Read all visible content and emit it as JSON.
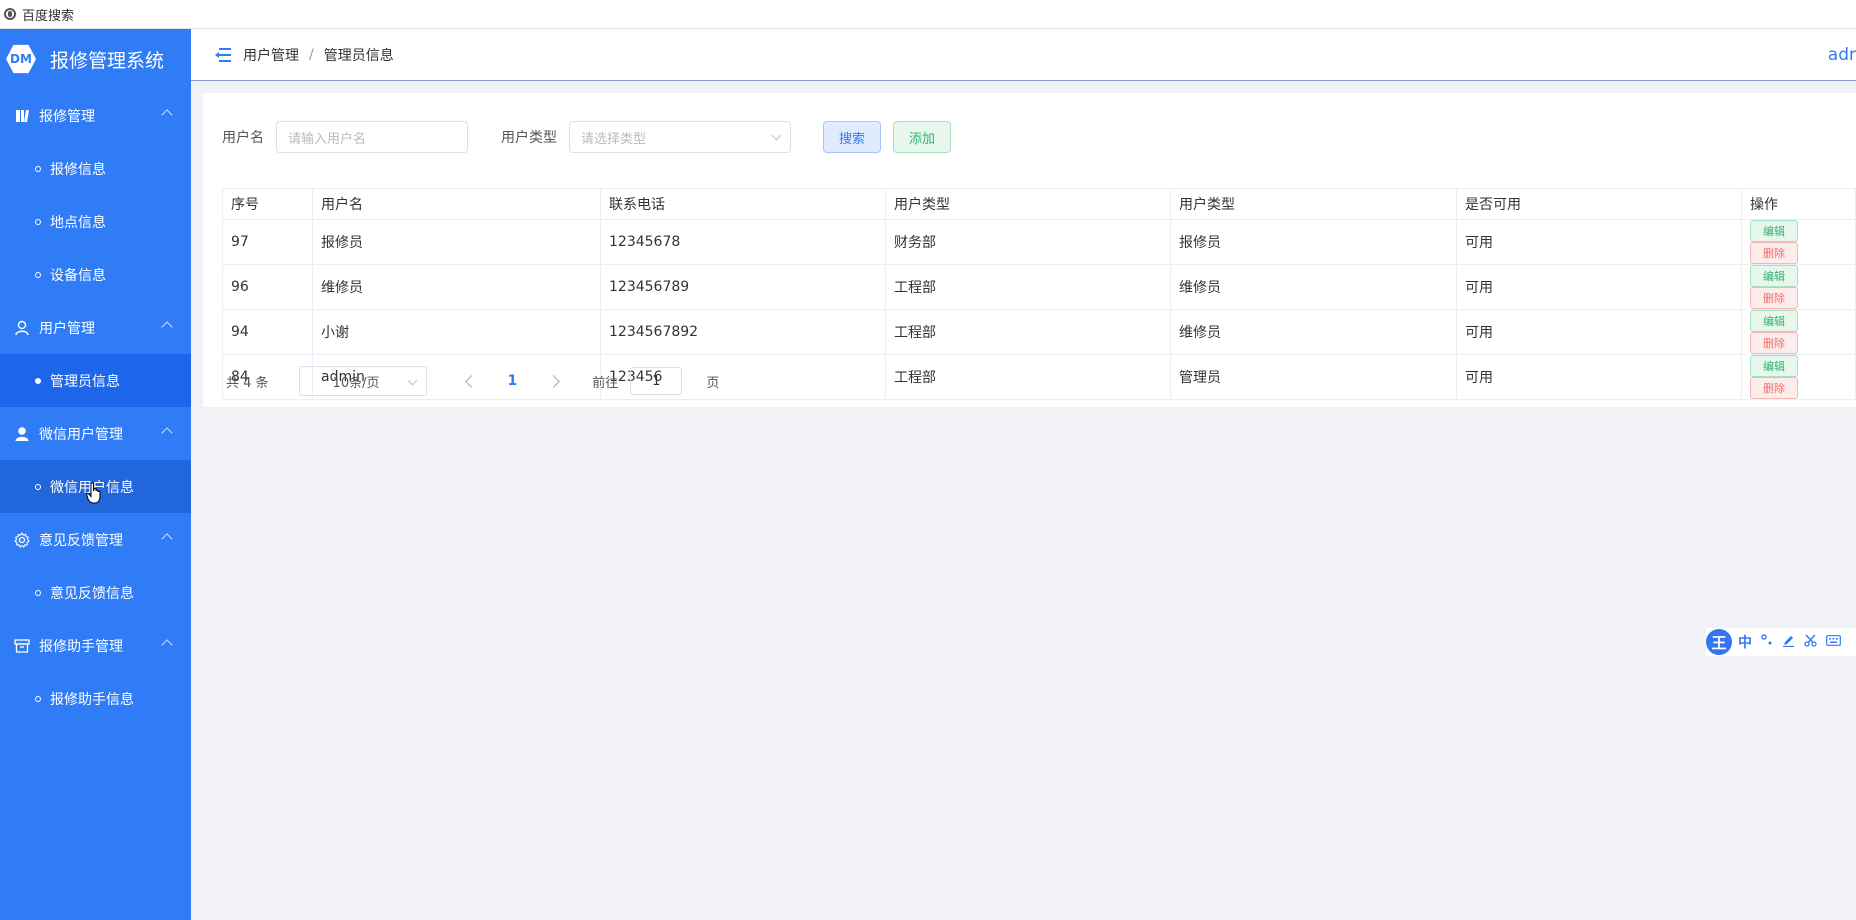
{
  "browser": {
    "bookmark": "百度搜索"
  },
  "sidebar": {
    "logo": "DM",
    "title": "报修管理系统",
    "groups": [
      {
        "label": "报修管理",
        "icon": "book-icon",
        "items": [
          "报修信息",
          "地点信息",
          "设备信息"
        ]
      },
      {
        "label": "用户管理",
        "icon": "user-icon",
        "items": [
          "管理员信息"
        ]
      },
      {
        "label": "微信用户管理",
        "icon": "person-icon",
        "items": [
          "微信用户信息"
        ]
      },
      {
        "label": "意见反馈管理",
        "icon": "gear-icon",
        "items": [
          "意见反馈信息"
        ]
      },
      {
        "label": "报修助手管理",
        "icon": "archive-icon",
        "items": [
          "报修助手信息"
        ]
      }
    ],
    "active_item": "管理员信息"
  },
  "header": {
    "breadcrumb": [
      "用户管理",
      "管理员信息"
    ],
    "user": "adr"
  },
  "search": {
    "username_label": "用户名",
    "username_placeholder": "请输入用户名",
    "type_label": "用户类型",
    "type_placeholder": "请选择类型",
    "search_button": "搜索",
    "add_button": "添加"
  },
  "table": {
    "columns": [
      "序号",
      "用户名",
      "联系电话",
      "用户类型",
      "用户类型",
      "是否可用",
      "操作"
    ],
    "rows": [
      [
        "97",
        "报修员",
        "12345678",
        "财务部",
        "报修员",
        "可用"
      ],
      [
        "96",
        "维修员",
        "123456789",
        "工程部",
        "维修员",
        "可用"
      ],
      [
        "94",
        "小谢",
        "1234567892",
        "工程部",
        "维修员",
        "可用"
      ],
      [
        "84",
        "admin",
        "123456",
        "工程部",
        "管理员",
        "可用"
      ]
    ],
    "edit_label": "编辑",
    "delete_label": "删除"
  },
  "pagination": {
    "total": "共 4 条",
    "page_size": "10条/页",
    "current_page": "1",
    "goto_label": "前往",
    "goto_value": "1",
    "page_suffix": "页"
  },
  "ime": {
    "logo": "王",
    "mode": "中"
  },
  "colors": {
    "sidebar": "#2f7cf6",
    "active": "#1d66ea",
    "success": "#32b16c",
    "danger": "#f56c6c"
  }
}
